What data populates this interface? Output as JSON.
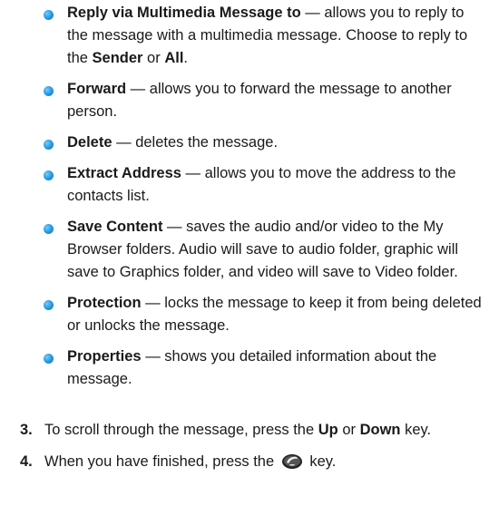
{
  "options": [
    {
      "term": "Reply via Multimedia Message to",
      "desc_parts": [
        {
          "t": " — allows you to reply to the message with a multimedia message. Choose to reply to the ",
          "b": false
        },
        {
          "t": "Sender",
          "b": true
        },
        {
          "t": " or ",
          "b": false
        },
        {
          "t": "All",
          "b": true
        },
        {
          "t": ".",
          "b": false
        }
      ]
    },
    {
      "term": "Forward",
      "desc_parts": [
        {
          "t": " — allows you to forward the message to another person.",
          "b": false
        }
      ]
    },
    {
      "term": "Delete",
      "desc_parts": [
        {
          "t": " — deletes the message.",
          "b": false
        }
      ]
    },
    {
      "term": "Extract Address",
      "desc_parts": [
        {
          "t": " — allows you to move the address to the contacts list.",
          "b": false
        }
      ]
    },
    {
      "term": "Save Content",
      "desc_parts": [
        {
          "t": " — saves the audio and/or video to the My Browser folders. Audio will save to audio folder, graphic will save to Graphics folder, and video will save to Video folder.",
          "b": false
        }
      ]
    },
    {
      "term": "Protection",
      "desc_parts": [
        {
          "t": " — locks the message to keep it from being deleted or unlocks the message.",
          "b": false
        }
      ]
    },
    {
      "term": "Properties",
      "desc_parts": [
        {
          "t": " — shows you detailed information about the message.",
          "b": false
        }
      ]
    }
  ],
  "steps": [
    {
      "number": "3.",
      "parts": [
        {
          "t": "To scroll through the message, press the ",
          "b": false
        },
        {
          "t": "Up",
          "b": true
        },
        {
          "t": " or ",
          "b": false
        },
        {
          "t": "Down",
          "b": true
        },
        {
          "t": " key.",
          "b": false
        }
      ]
    },
    {
      "number": "4.",
      "before_icon": "When you have finished, press the ",
      "icon": "end-key-icon",
      "after_icon": " key."
    }
  ],
  "colors": {
    "bullet": "#1f96e0",
    "text": "#1a1a1a"
  }
}
